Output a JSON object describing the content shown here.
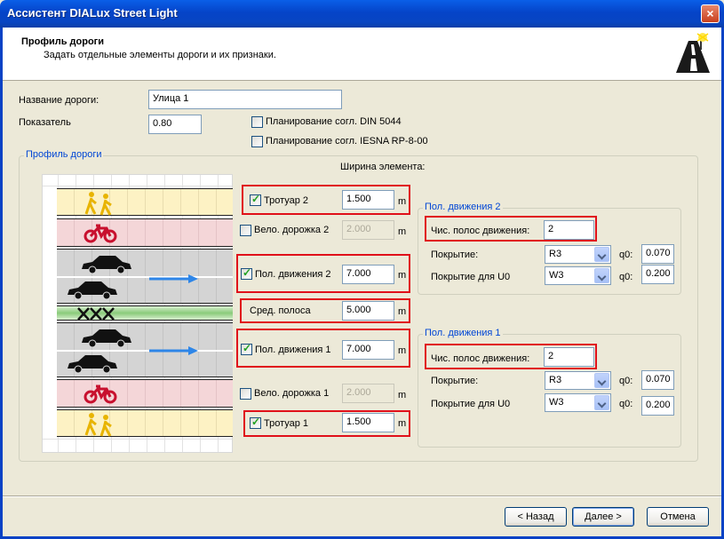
{
  "window": {
    "title": "Ассистент DIALux Street Light",
    "close_glyph": "×"
  },
  "header": {
    "title": "Профиль дороги",
    "subtitle": "Задать отдельные элементы дороги и их признаки."
  },
  "form": {
    "road_name_label": "Название дороги:",
    "road_name_value": "Улица 1",
    "indicator_label": "Показатель",
    "indicator_value": "0.80",
    "din_label": "Планирование согл. DIN 5044",
    "din_checked": false,
    "iesna_label": "Планирование согл. IESNA RP-8-00",
    "iesna_checked": false
  },
  "profile": {
    "group_label": "Профиль дороги",
    "width_header": "Ширина элемента:",
    "elements": [
      {
        "label": "Тротуар 2",
        "value": "1.500",
        "unit": "m",
        "checked": true,
        "enabled": true
      },
      {
        "label": "Вело. дорожка 2",
        "value": "2.000",
        "unit": "m",
        "checked": false,
        "enabled": false
      },
      {
        "label": "Пол. движения 2",
        "value": "7.000",
        "unit": "m",
        "checked": true,
        "enabled": true
      },
      {
        "label": "Сред. полоса",
        "value": "5.000",
        "unit": "m",
        "checked": null,
        "enabled": true
      },
      {
        "label": "Пол. движения 1",
        "value": "7.000",
        "unit": "m",
        "checked": true,
        "enabled": true
      },
      {
        "label": "Вело. дорожка 1",
        "value": "2.000",
        "unit": "m",
        "checked": false,
        "enabled": false
      },
      {
        "label": "Тротуар 1",
        "value": "1.500",
        "unit": "m",
        "checked": true,
        "enabled": true
      }
    ]
  },
  "lane2": {
    "group_label": "Пол. движения 2",
    "lanes_label": "Чис. полос движения:",
    "lanes_value": "2",
    "surface_label": "Покрытие:",
    "surface_value": "R3",
    "q0_label": "q0:",
    "q0_value": "0.070",
    "surface_u0_label": "Покрытие для U0",
    "surface_u0_value": "W3",
    "q0_u0_label": "q0:",
    "q0_u0_value": "0.200"
  },
  "lane1": {
    "group_label": "Пол. движения 1",
    "lanes_label": "Чис. полос движения:",
    "lanes_value": "2",
    "surface_label": "Покрытие:",
    "surface_value": "R3",
    "q0_label": "q0:",
    "q0_value": "0.070",
    "surface_u0_label": "Покрытие для U0",
    "surface_u0_value": "W3",
    "q0_u0_label": "q0:",
    "q0_u0_value": "0.200"
  },
  "buttons": {
    "back": "< Назад",
    "next": "Далее >",
    "cancel": "Отмена"
  },
  "colors": {
    "highlight_box": "#E0101A",
    "title_bar": "#0544C8",
    "group_legend": "#0046D5"
  }
}
